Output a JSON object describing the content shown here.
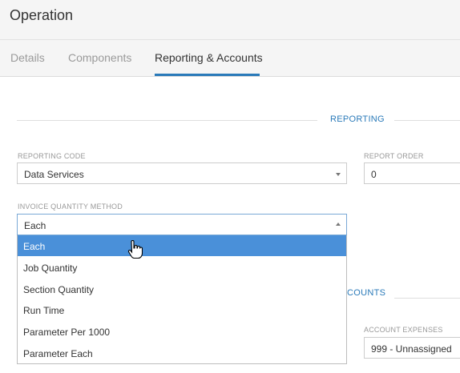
{
  "header": {
    "title": "Operation"
  },
  "tabs": [
    {
      "label": "Details"
    },
    {
      "label": "Components"
    },
    {
      "label": "Reporting & Accounts"
    }
  ],
  "reporting": {
    "section_label": "REPORTING",
    "reporting_code": {
      "label": "REPORTING CODE",
      "value": "Data Services"
    },
    "report_order": {
      "label": "REPORT ORDER",
      "value": "0"
    },
    "invoice_quantity_method": {
      "label": "INVOICE QUANTITY METHOD",
      "value": "Each",
      "options": [
        "Each",
        "Job Quantity",
        "Section Quantity",
        "Run Time",
        "Parameter Per 1000",
        "Parameter Each"
      ]
    }
  },
  "accounts": {
    "section_label_partial": "COUNTS",
    "account_expenses": {
      "label": "ACCOUNT EXPENSES",
      "value": "999 - Unnassigned"
    }
  }
}
